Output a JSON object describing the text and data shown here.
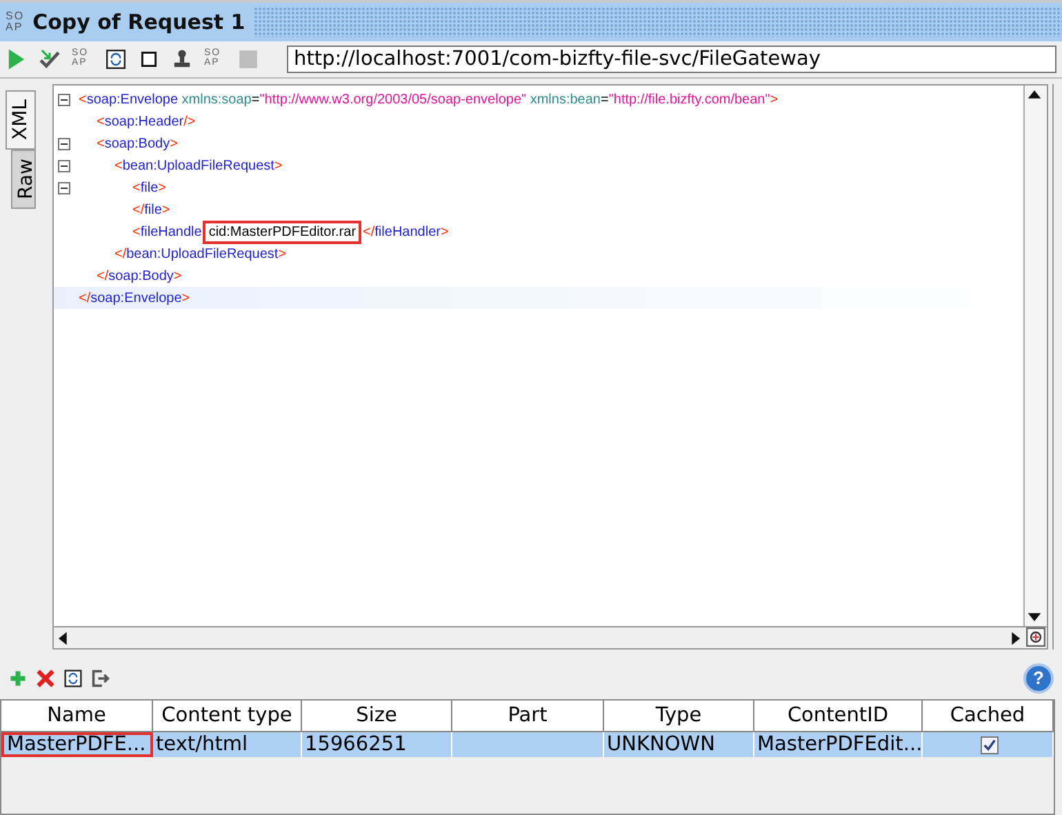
{
  "title_bar": {
    "icon_lines": [
      "SO",
      "AP"
    ],
    "title": "Copy of Request 1"
  },
  "toolbar": {
    "items": [
      {
        "kind": "play"
      },
      {
        "kind": "check"
      },
      {
        "kind": "soap",
        "lines": [
          "SO",
          "AP"
        ]
      },
      {
        "kind": "refresh"
      },
      {
        "kind": "square"
      },
      {
        "kind": "stamp"
      },
      {
        "kind": "soap",
        "lines": [
          "SO",
          "AP"
        ]
      },
      {
        "kind": "stop"
      }
    ],
    "url": "http://localhost:7001/com-bizfty-file-svc/FileGateway"
  },
  "side_tabs": [
    {
      "label": "XML",
      "selected": true
    },
    {
      "label": "Raw",
      "selected": false
    }
  ],
  "editor": {
    "lines": [
      {
        "fold": true,
        "current": false,
        "tokens": [
          {
            "kind": "bracket",
            "text": "<"
          },
          {
            "kind": "name",
            "text": "soap:Envelope"
          },
          {
            "kind": "attr",
            "text": " xmlns:soap"
          },
          {
            "kind": "eq",
            "text": "="
          },
          {
            "kind": "value",
            "text": "\"http://www.w3.org/2003/05/soap-envelope\""
          },
          {
            "kind": "attr",
            "text": " xmlns:bean"
          },
          {
            "kind": "eq",
            "text": "="
          },
          {
            "kind": "value",
            "text": "\"http://file.bizfty.com/bean\""
          },
          {
            "kind": "bracket",
            "text": ">"
          }
        ],
        "children": [
          {
            "fold": false,
            "current": false,
            "tokens": [
              {
                "kind": "bracket",
                "text": "<"
              },
              {
                "kind": "name",
                "text": "soap:Header"
              },
              {
                "kind": "bracket",
                "text": "/>"
              }
            ]
          },
          {
            "fold": true,
            "current": false,
            "tokens": [
              {
                "kind": "bracket",
                "text": "<"
              },
              {
                "kind": "name",
                "text": "soap:Body"
              },
              {
                "kind": "bracket",
                "text": ">"
              }
            ],
            "children": [
              {
                "fold": true,
                "current": false,
                "tokens": [
                  {
                    "kind": "bracket",
                    "text": "<"
                  },
                  {
                    "kind": "name",
                    "text": "bean:UploadFileRequest"
                  },
                  {
                    "kind": "bracket",
                    "text": ">"
                  }
                ],
                "children": [
                  {
                    "fold": true,
                    "current": false,
                    "tokens": [
                      {
                        "kind": "bracket",
                        "text": "<"
                      },
                      {
                        "kind": "name",
                        "text": "file"
                      },
                      {
                        "kind": "bracket",
                        "text": ">"
                      }
                    ]
                  },
                  {
                    "fold": false,
                    "current": false,
                    "tokens": [
                      {
                        "kind": "bracket",
                        "text": "</"
                      },
                      {
                        "kind": "name",
                        "text": "file"
                      },
                      {
                        "kind": "bracket",
                        "text": ">"
                      }
                    ]
                  },
                  {
                    "fold": false,
                    "current": false,
                    "tokens": [
                      {
                        "kind": "bracket",
                        "text": "<"
                      },
                      {
                        "kind": "name",
                        "text": "fileHandle"
                      },
                      {
                        "kind": "text",
                        "text": "cid:MasterPDFEditor.rar",
                        "highlight": true
                      },
                      {
                        "kind": "bracket",
                        "text": "</"
                      },
                      {
                        "kind": "name",
                        "text": "fileHandler"
                      },
                      {
                        "kind": "bracket",
                        "text": ">"
                      }
                    ]
                  }
                ]
              },
              {
                "fold": false,
                "current": false,
                "tokens": [
                  {
                    "kind": "bracket",
                    "text": "</"
                  },
                  {
                    "kind": "name",
                    "text": "bean:UploadFileRequest"
                  },
                  {
                    "kind": "bracket",
                    "text": ">"
                  }
                ]
              }
            ]
          },
          {
            "fold": false,
            "current": false,
            "tokens": [
              {
                "kind": "bracket",
                "text": "</"
              },
              {
                "kind": "name",
                "text": "soap:Body"
              },
              {
                "kind": "bracket",
                "text": ">"
              }
            ]
          }
        ]
      },
      {
        "fold": false,
        "current": true,
        "tokens": [
          {
            "kind": "bracket",
            "text": "</"
          },
          {
            "kind": "name",
            "text": "soap:Envelope"
          },
          {
            "kind": "bracket",
            "text": ">"
          }
        ]
      }
    ]
  },
  "attachments": {
    "toolbar": [
      {
        "kind": "add"
      },
      {
        "kind": "delete"
      },
      {
        "kind": "refresh"
      },
      {
        "kind": "export"
      }
    ],
    "help": "?",
    "columns": [
      "Name",
      "Content type",
      "Size",
      "Part",
      "Type",
      "ContentID",
      "Cached"
    ],
    "rows": [
      {
        "selected": true,
        "cells": [
          {
            "text": "MasterPDFE...",
            "highlight": true
          },
          {
            "text": "text/html"
          },
          {
            "text": "15966251"
          },
          {
            "text": ""
          },
          {
            "text": "UNKNOWN"
          },
          {
            "text": "MasterPDFEdit..."
          }
        ],
        "cached": true
      }
    ]
  }
}
